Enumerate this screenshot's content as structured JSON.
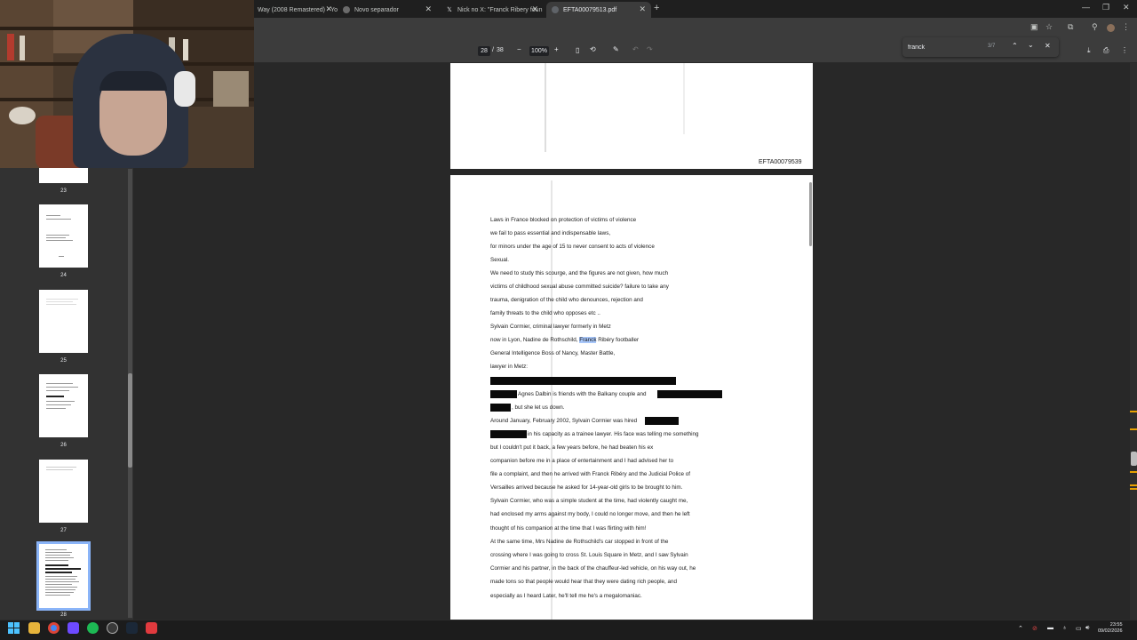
{
  "tabs": [
    {
      "label": "Way (2008 Remastered) - Yo",
      "icon": "youtube-icon"
    },
    {
      "label": "Novo separador",
      "icon": "chrome-icon"
    },
    {
      "label": "Nick no X: \"Franck Ribery foun",
      "icon": "x-icon"
    },
    {
      "label": "EFTA00079513.pdf",
      "icon": "pdf-icon"
    }
  ],
  "find": {
    "query": "franck",
    "count": "3/7"
  },
  "pdf": {
    "page_current": "28",
    "page_sep": "/",
    "page_total": "38",
    "zoom": "100%"
  },
  "sidebar": {
    "thumbnails": [
      {
        "label": "23"
      },
      {
        "label": "24"
      },
      {
        "label": "25"
      },
      {
        "label": "26"
      },
      {
        "label": "27"
      },
      {
        "label": "28"
      }
    ]
  },
  "document": {
    "prev_page_id": "EFTA00079539",
    "lines": {
      "l1": "Laws in France blocked on protection of victims of violence",
      "l2": "we fail to pass essential and indispensable laws,",
      "l3": "for minors under the age of 15 to never consent to acts of violence",
      "l4": "Sexual.",
      "l5": "We need to study this scourge, and the figures are not given, how much",
      "l6": "victims of childhood sexual abuse committed suicide? failure to take any",
      "l7": "trauma, denigration of the child who denounces, rejection and",
      "l8": "family threats to the child who opposes etc ..",
      "l9": "Sylvain Cormier, criminal lawyer formerly in Metz",
      "l10a": "now in Lyon, Nadine de Rothschild,",
      "l10b": "Franck",
      "l10c": "Ribéry footballer",
      "l11": "General Intelligence Boss of Nancy, Master Battle,",
      "l12": "lawyer in Metz:",
      "l13": "Agnes Dalbin is friends with the Balkany couple and",
      "l14": ", but she let us down.",
      "l15": "Around January, February 2002, Sylvain Cormier was hired",
      "l16": "in his capacity as a trainee lawyer. His face was telling me something",
      "l17": "but I couldn't put it back, a few years before, he had beaten his ex",
      "l18": "companion before me in a place of entertainment and I had advised her to",
      "l19": "file a complaint, and then he arrived with Franck Ribéry and the Judicial Police of",
      "l20": "Versailles arrived because he asked for 14-year-old girls to be brought to him.",
      "l21": "Sylvain Cormier, who was a simple student at the time, had violently caught me,",
      "l22": "had enclosed my arms against my body, I could no longer move, and then he left",
      "l23": "thought of his companion at the time that I was flirting with him!",
      "l24": "At the same time, Mrs Nadine de Rothschild's car stopped in front of the",
      "l25": "crossing where I was going to cross St. Louis Square in Metz, and I saw Sylvain",
      "l26": "Cormier and his partner, in the back of the chauffeur-led vehicle, on his way out, he",
      "l27": "made tons so that people would hear that they were dating rich people, and",
      "l28": "especially as I heard Later, he'll tell me he's a megalomaniac."
    }
  },
  "taskbar": {
    "time": "23:55",
    "date": "09/02/2026"
  }
}
